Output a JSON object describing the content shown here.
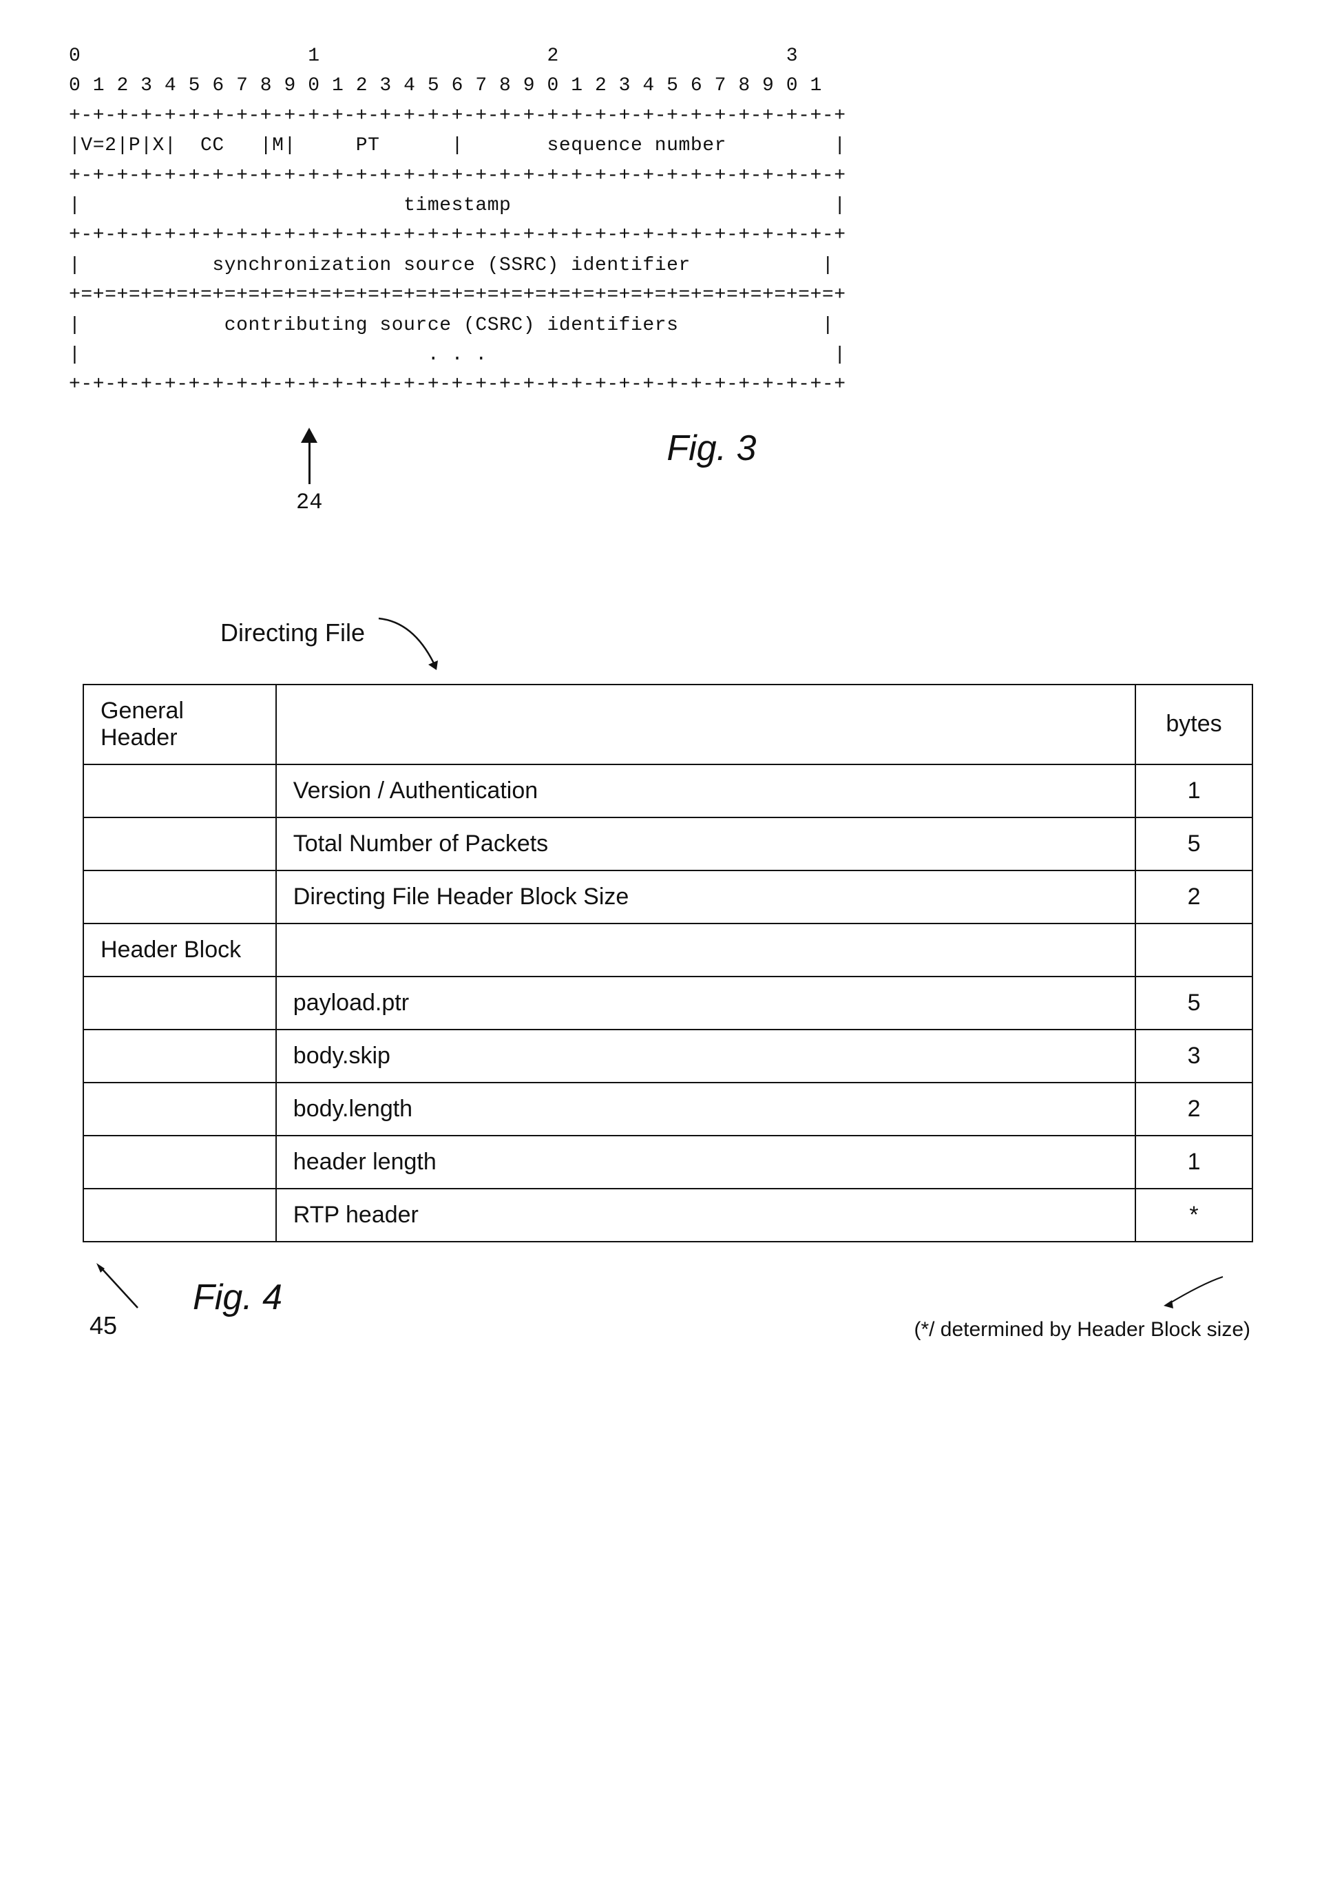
{
  "fig3": {
    "title": "Fig. 3",
    "label_24": "24",
    "diagram_lines": [
      "0                   1                   2                   3",
      "0 1 2 3 4 5 6 7 8 9 0 1 2 3 4 5 6 7 8 9 0 1 2 3 4 5 6 7 8 9 0 1",
      "+-+-+-+-+-+-+-+-+-+-+-+-+-+-+-+-+-+-+-+-+-+-+-+-+-+-+-+-+-+-+-+-+",
      "|V=2|P|X|  CC   |M|     PT      |       sequence number         |",
      "+-+-+-+-+-+-+-+-+-+-+-+-+-+-+-+-+-+-+-+-+-+-+-+-+-+-+-+-+-+-+-+-+",
      "|                           timestamp                           |",
      "+-+-+-+-+-+-+-+-+-+-+-+-+-+-+-+-+-+-+-+-+-+-+-+-+-+-+-+-+-+-+-+-+",
      "|           synchronization source (SSRC) identifier           |",
      "+=+=+=+=+=+=+=+=+=+=+=+=+=+=+=+=+=+=+=+=+=+=+=+=+=+=+=+=+=+=+=+=+",
      "|            contributing source (CSRC) identifiers            |",
      "|                             . . .                             |",
      "+-+-+-+-+-+-+-+-+-+-+-+-+-+-+-+-+-+-+-+-+-+-+-+-+-+-+-+-+-+-+-+-+"
    ]
  },
  "fig4": {
    "title": "Fig. 4",
    "label_45": "45",
    "directing_file_label": "Directing File",
    "note": "(*/ determined by Header Block size)",
    "table": {
      "rows": [
        {
          "col_left": "General Header",
          "col_mid": "",
          "col_right": "bytes"
        },
        {
          "col_left": "",
          "col_mid": "Version / Authentication",
          "col_right": "1"
        },
        {
          "col_left": "",
          "col_mid": "Total Number of Packets",
          "col_right": "5"
        },
        {
          "col_left": "",
          "col_mid": "Directing File Header Block Size",
          "col_right": "2"
        },
        {
          "col_left": "Header Block",
          "col_mid": "",
          "col_right": ""
        },
        {
          "col_left": "",
          "col_mid": "payload.ptr",
          "col_right": "5"
        },
        {
          "col_left": "",
          "col_mid": "body.skip",
          "col_right": "3"
        },
        {
          "col_left": "",
          "col_mid": "body.length",
          "col_right": "2"
        },
        {
          "col_left": "",
          "col_mid": "header length",
          "col_right": "1"
        },
        {
          "col_left": "",
          "col_mid": "RTP header",
          "col_right": "*"
        }
      ]
    }
  }
}
